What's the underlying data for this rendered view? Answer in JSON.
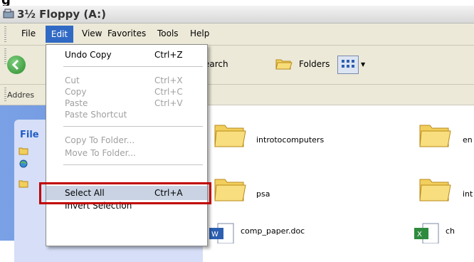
{
  "window": {
    "title": "3½ Floppy (A:)"
  },
  "menubar": {
    "items": [
      "File",
      "Edit",
      "View",
      "Favorites",
      "Tools",
      "Help"
    ]
  },
  "toolbar": {
    "search_label": "earch",
    "folders_label": "Folders"
  },
  "addressbar": {
    "label": "Addres"
  },
  "taskpane": {
    "header": "File"
  },
  "edit_menu": {
    "items": [
      {
        "label": "Undo Copy",
        "shortcut": "Ctrl+Z",
        "enabled": true
      },
      {
        "label": "Cut",
        "shortcut": "Ctrl+X",
        "enabled": false
      },
      {
        "label": "Copy",
        "shortcut": "Ctrl+C",
        "enabled": false
      },
      {
        "label": "Paste",
        "shortcut": "Ctrl+V",
        "enabled": false
      },
      {
        "label": "Paste Shortcut",
        "shortcut": "",
        "enabled": false
      },
      {
        "label": "Copy To Folder...",
        "shortcut": "",
        "enabled": false
      },
      {
        "label": "Move To Folder...",
        "shortcut": "",
        "enabled": false
      },
      {
        "label": "Select All",
        "shortcut": "Ctrl+A",
        "enabled": true,
        "highlighted": true
      },
      {
        "label": "Invert Selection",
        "shortcut": "",
        "enabled": true
      }
    ]
  },
  "files": [
    {
      "name": "introtocomputers",
      "type": "folder"
    },
    {
      "name": "en",
      "type": "folder"
    },
    {
      "name": "psa",
      "type": "folder"
    },
    {
      "name": "int",
      "type": "folder"
    },
    {
      "name": "comp_paper.doc",
      "type": "doc"
    },
    {
      "name": "ch",
      "type": "xls"
    }
  ],
  "colors": {
    "menu_highlight": "#316ac5",
    "annotation_box": "#c00000",
    "taskpane": "#7aa1e6"
  }
}
